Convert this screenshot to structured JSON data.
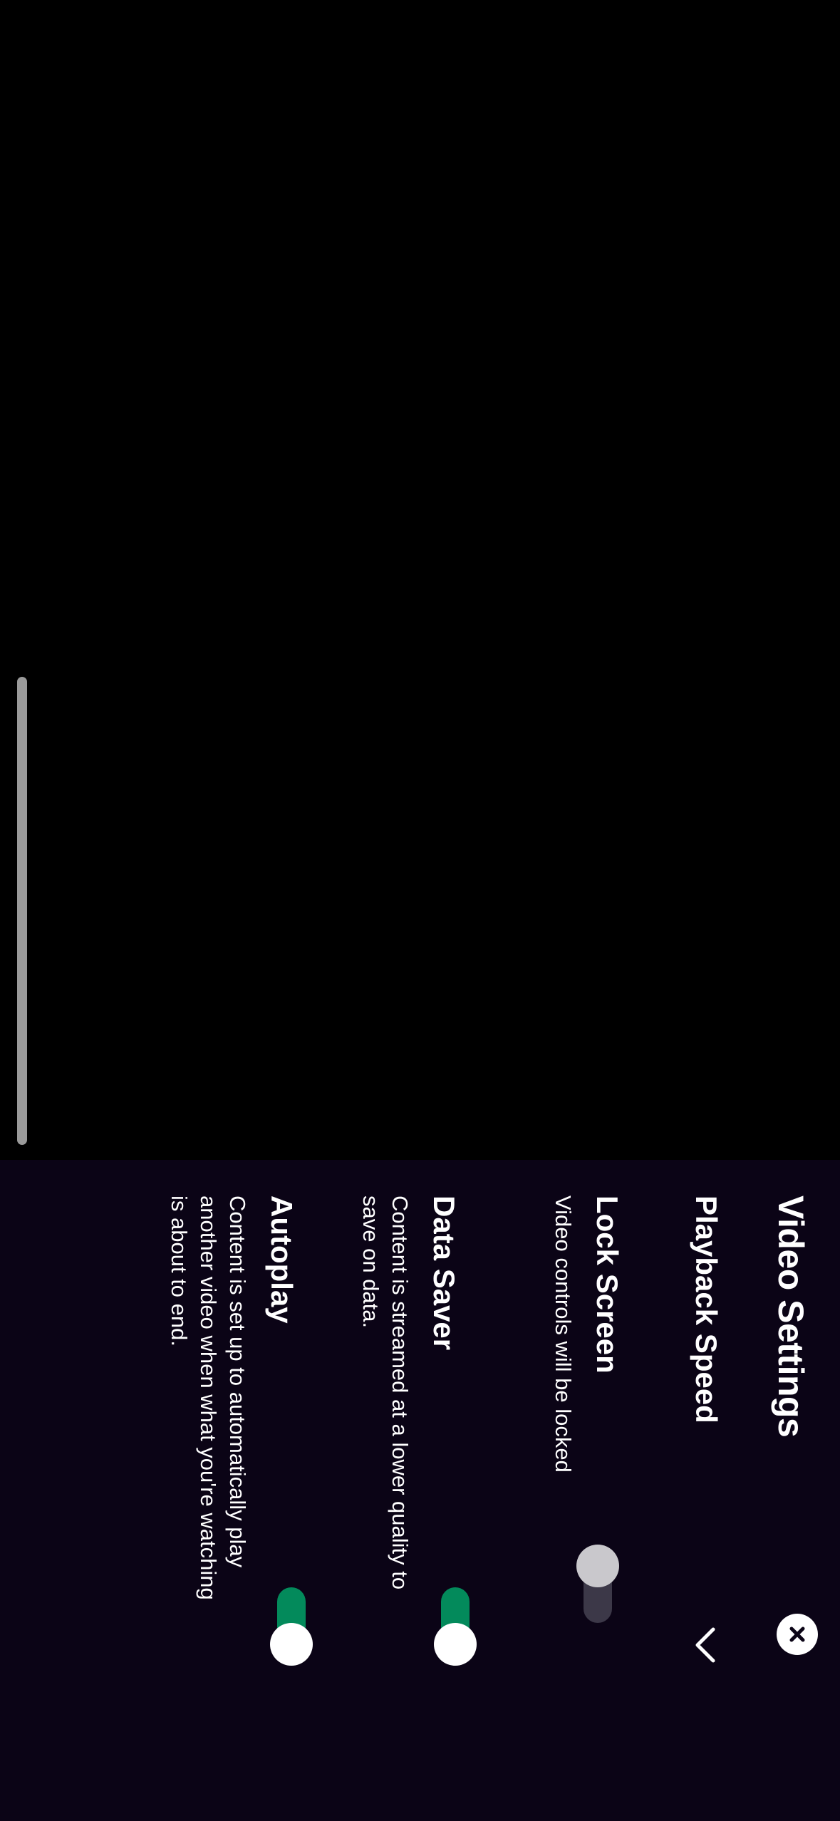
{
  "panel": {
    "title": "Video Settings"
  },
  "settings": {
    "playback_speed": {
      "label": "Playback Speed"
    },
    "lock_screen": {
      "label": "Lock Screen",
      "description": "Video controls will be locked",
      "enabled": false
    },
    "data_saver": {
      "label": "Data Saver",
      "description": "Content is streamed at a lower quality to save on data.",
      "enabled": true
    },
    "autoplay": {
      "label": "Autoplay",
      "description": "Content is set up to automatically play another video when what you're watching is about to end.",
      "enabled": true
    }
  },
  "colors": {
    "sheet_background": "#0b0416",
    "toggle_on": "#038a5b",
    "toggle_off_track": "#3c3848"
  },
  "icons": {
    "close": "close-icon",
    "expand": "chevron-down-icon"
  }
}
